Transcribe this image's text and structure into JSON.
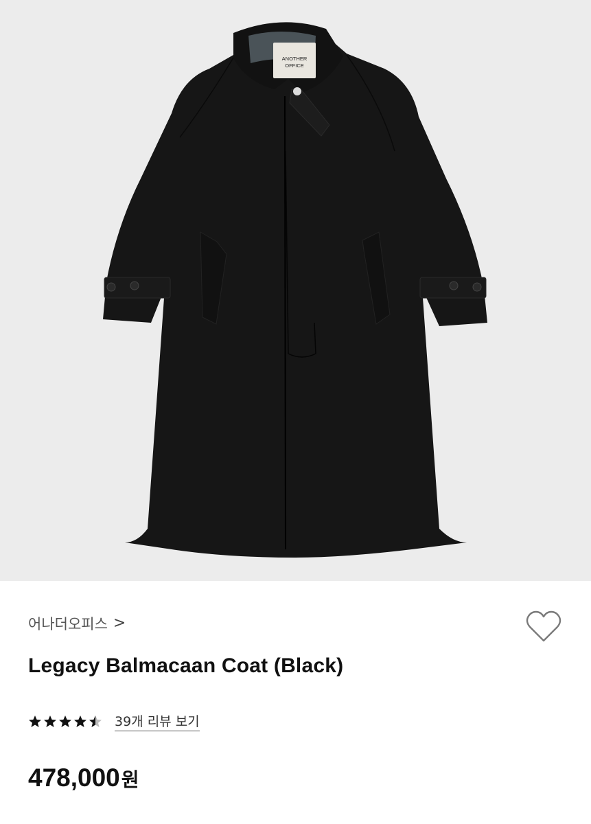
{
  "product": {
    "brand": "어나더오피스",
    "brand_chevron": ">",
    "title": "Legacy Balmacaan Coat (Black)",
    "label_text": "ANOTHER OFFICE",
    "rating": 4.5,
    "review_link": "39개 리뷰 보기",
    "price": "478,000",
    "currency": "원"
  },
  "icons": {
    "wishlist": "heart-outline-icon",
    "star": "star-icon",
    "chevron": "chevron-right-icon"
  },
  "colors": {
    "hero_bg": "#ececec",
    "coat": "#161616",
    "text": "#111111",
    "brand_text": "#555555"
  }
}
